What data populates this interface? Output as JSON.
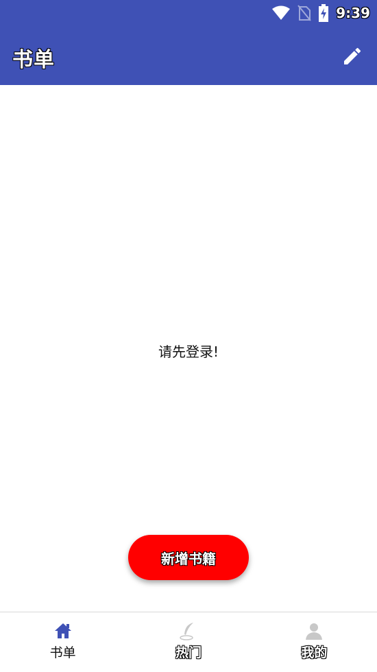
{
  "status_bar": {
    "time": "9:39",
    "icons": [
      "wifi-icon",
      "no-sim-icon",
      "battery-charging-icon"
    ]
  },
  "app_bar": {
    "title": "书单",
    "action_icon": "edit-icon"
  },
  "content": {
    "empty_message": "请先登录!"
  },
  "fab": {
    "label": "新增书籍",
    "color": "#ff0000"
  },
  "bottom_nav": {
    "items": [
      {
        "label": "书单",
        "icon": "home-icon",
        "active": true
      },
      {
        "label": "热门",
        "icon": "feather-icon",
        "active": false
      },
      {
        "label": "我的",
        "icon": "person-icon",
        "active": false
      }
    ]
  },
  "colors": {
    "primary": "#3F51B5",
    "accent": "#ff0000"
  }
}
